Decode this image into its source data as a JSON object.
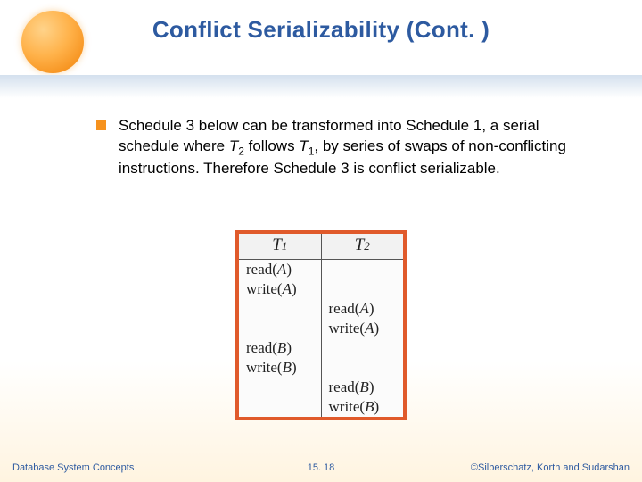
{
  "title": "Conflict Serializability (Cont. )",
  "bullet": {
    "pre": "Schedule 3 below can be transformed into Schedule 1, a serial schedule where ",
    "t2": "T",
    "t2sub": "2",
    "mid1": " follows ",
    "t1": "T",
    "t1sub": "1",
    "post": ", by series of swaps of non-conflicting instructions.  Therefore Schedule 3 is conflict serializable."
  },
  "schedule": {
    "headers": {
      "c1": "T",
      "c1sub": "1",
      "c2": "T",
      "c2sub": "2"
    },
    "rows": [
      {
        "c1": "read(A)",
        "c2": ""
      },
      {
        "c1": "write(A)",
        "c2": ""
      },
      {
        "c1": "",
        "c2": "read(A)"
      },
      {
        "c1": "",
        "c2": "write(A)"
      },
      {
        "c1": "read(B)",
        "c2": ""
      },
      {
        "c1": "write(B)",
        "c2": ""
      },
      {
        "c1": "",
        "c2": "read(B)"
      },
      {
        "c1": "",
        "c2": "write(B)"
      }
    ]
  },
  "footer": {
    "left": "Database System Concepts",
    "center": "15. 18",
    "right": "©Silberschatz, Korth and Sudarshan"
  }
}
